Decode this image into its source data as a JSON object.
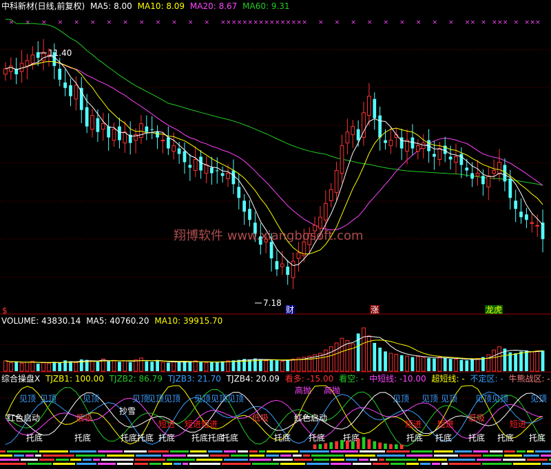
{
  "main_header": {
    "title": "中科新材(日线,前复权)",
    "ma5": "MA5: 8.00",
    "ma10": "MA10: 8.09",
    "ma20": "MA20: 8.67",
    "ma60": "MA60: 9.31"
  },
  "annotations": {
    "high_label": "11.40",
    "low_label": "7.18",
    "watermark": "翔博软件 www.xiangbosoft.com",
    "tag_dollar": "$",
    "tag_cai": "财",
    "tag_zhang": "涨",
    "tag_longhu": "龙虎"
  },
  "volume_header": {
    "volume": "VOLUME: 43830.14",
    "ma5": "MA5: 40760.20",
    "ma10": "MA10: 39915.70"
  },
  "indicator_header": {
    "name": "综合操盘X",
    "tjzb1": "TJZB1: 100.00",
    "tjzb2": "TJZB2: 86.79",
    "tjzb3": "TJZB3: 21.70",
    "tjzb4": "TJZB4: 20.09",
    "kanduo": "看多: -15.00",
    "kankong": "看空: -",
    "zhongduan": "中短线: -10.00",
    "chaoduan": "超短线: -",
    "buding": "不定区: -",
    "niuneng": "牛熊战区: -5.00"
  },
  "indicator_labels": [
    {
      "t": "见顶",
      "c": "#3aa0ff"
    },
    {
      "t": "见顶",
      "c": "#3aa0ff"
    },
    {
      "t": "见顶",
      "c": "#3aa0ff"
    },
    {
      "t": "见顶",
      "c": "#3aa0ff"
    },
    {
      "t": "见顶见顶",
      "c": "#3aa0ff"
    },
    {
      "t": "见顶见顶见顶",
      "c": "#3aa0ff"
    },
    {
      "t": "高抛",
      "c": "#ff44ff"
    },
    {
      "t": "高抛",
      "c": "#ff44ff"
    },
    {
      "t": "见顶",
      "c": "#3aa0ff"
    },
    {
      "t": "见顶",
      "c": "#3aa0ff"
    },
    {
      "t": "见顶",
      "c": "#3aa0ff"
    },
    {
      "t": "见顶见顶",
      "c": "#3aa0ff"
    },
    {
      "t": "见顶",
      "c": "#3aa0ff"
    },
    {
      "t": "红色启动",
      "c": "#ffffff"
    },
    {
      "t": "低吸",
      "c": "#ff4040"
    },
    {
      "t": "抄雪",
      "c": "#ffffff"
    },
    {
      "t": "短进",
      "c": "#ff2020"
    },
    {
      "t": "短进短进",
      "c": "#ff2020"
    },
    {
      "t": "低吸",
      "c": "#ff4040"
    },
    {
      "t": "红色启动",
      "c": "#ffffff"
    },
    {
      "t": "短进",
      "c": "#ff2020"
    },
    {
      "t": "短进",
      "c": "#ff2020"
    },
    {
      "t": "低吸",
      "c": "#ff4040"
    },
    {
      "t": "短进",
      "c": "#ff2020"
    },
    {
      "t": "托底",
      "c": "#ffffff"
    },
    {
      "t": "托底",
      "c": "#ffffff"
    },
    {
      "t": "托底托底",
      "c": "#ffffff"
    },
    {
      "t": "托底",
      "c": "#ffffff"
    },
    {
      "t": "托底托底",
      "c": "#ffffff"
    },
    {
      "t": "托底",
      "c": "#ffffff"
    },
    {
      "t": "托底",
      "c": "#ffffff"
    },
    {
      "t": "托底",
      "c": "#ffffff"
    },
    {
      "t": "托底",
      "c": "#ffffff"
    },
    {
      "t": "托底",
      "c": "#ffffff"
    },
    {
      "t": "托底",
      "c": "#ffffff"
    },
    {
      "t": "托底",
      "c": "#ffffff"
    },
    {
      "t": "托底",
      "c": "#ffffff"
    },
    {
      "t": "托底",
      "c": "#ffffff"
    }
  ],
  "colors": {
    "up": "#ff3232",
    "down": "#54ffff",
    "ma5": "#ffffff",
    "ma10": "#ffff00",
    "ma20": "#ff44ff",
    "ma60": "#22cc22",
    "grid": "#800000"
  },
  "chart_data": {
    "type": "candlestick",
    "title": "中科新材(日线,前复权)",
    "price_range": [
      6.6,
      12.1
    ],
    "marked_high": 11.4,
    "marked_low": 7.18,
    "closes": [
      11.05,
      11.1,
      10.95,
      11.15,
      11.2,
      11.3,
      11.25,
      11.35,
      11.3,
      11.1,
      10.85,
      10.7,
      10.55,
      10.75,
      10.3,
      10.0,
      10.2,
      9.9,
      10.05,
      9.8,
      9.95,
      9.75,
      9.9,
      9.7,
      9.85,
      10.05,
      9.9,
      9.95,
      9.8,
      9.75,
      9.6,
      9.65,
      9.5,
      9.35,
      9.25,
      9.4,
      9.2,
      9.3,
      9.15,
      9.2,
      9.1,
      9.15,
      8.95,
      8.7,
      8.45,
      8.3,
      8.05,
      7.85,
      7.95,
      7.6,
      7.4,
      7.5,
      7.3,
      7.55,
      7.7,
      7.9,
      8.05,
      8.2,
      8.35,
      8.6,
      8.85,
      9.2,
      9.65,
      9.9,
      10.0,
      9.75,
      10.25,
      10.55,
      10.15,
      9.8,
      9.7,
      9.75,
      9.85,
      9.6,
      9.75,
      9.6,
      9.65,
      9.7,
      9.55,
      9.45,
      9.6,
      9.5,
      9.4,
      9.45,
      9.3,
      9.2,
      9.05,
      9.15,
      8.95,
      9.1,
      9.2,
      9.35,
      9.0,
      8.7,
      8.5,
      8.35,
      8.3,
      8.25,
      8.2,
      7.95
    ],
    "volume_range": [
      0,
      95000
    ],
    "volumes": [
      22000,
      18000,
      20000,
      17000,
      19000,
      21000,
      16000,
      18000,
      17000,
      20000,
      19000,
      23000,
      21000,
      18000,
      25000,
      24000,
      22000,
      20000,
      26000,
      21000,
      23000,
      20000,
      22000,
      19000,
      24000,
      28000,
      21000,
      20000,
      22000,
      19000,
      18000,
      20000,
      19000,
      21000,
      20000,
      22000,
      19000,
      18000,
      20000,
      19000,
      21000,
      22000,
      23000,
      24000,
      26000,
      25000,
      27000,
      24000,
      22000,
      25000,
      23000,
      21000,
      24000,
      26000,
      28000,
      30000,
      32000,
      35000,
      38000,
      45000,
      52000,
      60000,
      70000,
      65000,
      58000,
      80000,
      92000,
      75000,
      60000,
      50000,
      42000,
      38000,
      36000,
      34000,
      32000,
      30000,
      31000,
      29000,
      28000,
      27000,
      30000,
      28000,
      26000,
      25000,
      24000,
      23000,
      26000,
      27000,
      30000,
      35000,
      45000,
      52000,
      48000,
      40000,
      38000,
      42000,
      44000,
      41000,
      43000,
      43830
    ],
    "volume_ma5": 40760.2,
    "volume_ma10": 39915.7
  }
}
